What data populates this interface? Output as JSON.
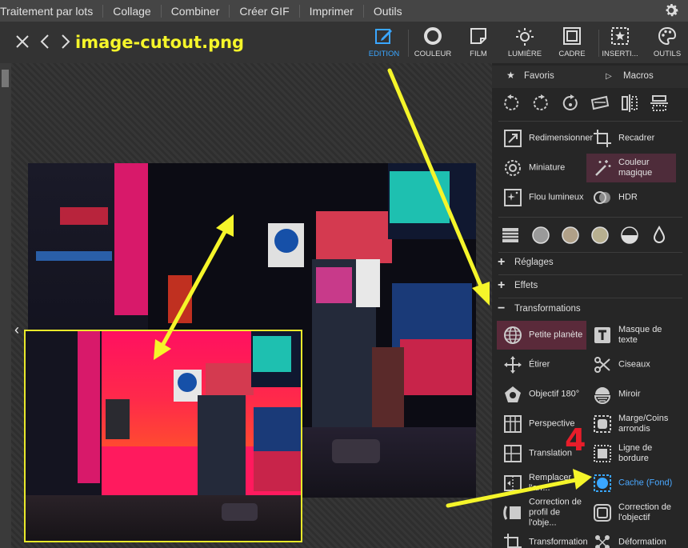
{
  "menu": {
    "items": [
      "Traitement par lots",
      "Collage",
      "Combiner",
      "Créer GIF",
      "Imprimer",
      "Outils"
    ]
  },
  "toolbar": {
    "filename": "image-cutout.png",
    "tools": [
      {
        "label": "EDITION",
        "icon": "edit-icon",
        "active": true
      },
      {
        "label": "COULEUR",
        "icon": "circle-icon"
      },
      {
        "label": "FILM",
        "icon": "film-icon"
      },
      {
        "label": "LUMIÈRE",
        "icon": "sun-icon"
      },
      {
        "label": "CADRE",
        "icon": "frame-icon"
      },
      {
        "label": "INSERTI...",
        "icon": "insert-icon"
      },
      {
        "label": "OUTILS",
        "icon": "palette-icon"
      }
    ]
  },
  "panel": {
    "favoris": "Favoris",
    "macros": "Macros",
    "tools": [
      {
        "label": "Redimensionner"
      },
      {
        "label": "Recadrer"
      },
      {
        "label": "Miniature"
      },
      {
        "label": "Couleur magique"
      },
      {
        "label": "Flou lumineux"
      },
      {
        "label": "HDR"
      }
    ],
    "sections": {
      "reglages": "Réglages",
      "effets": "Effets",
      "transformations": "Transformations"
    },
    "transformations": [
      {
        "label": "Petite planète"
      },
      {
        "label": "Masque de texte"
      },
      {
        "label": "Étirer"
      },
      {
        "label": "Ciseaux"
      },
      {
        "label": "Objectif 180°"
      },
      {
        "label": "Miroir"
      },
      {
        "label": "Perspective"
      },
      {
        "label": "Marge/Coins arrondis"
      },
      {
        "label": "Translation"
      },
      {
        "label": "Ligne de bordure"
      },
      {
        "label": "Remplacer l'arr..."
      },
      {
        "label": "Cache (Fond)"
      },
      {
        "label": "Correction de profil de l'obje..."
      },
      {
        "label": "Correction de l'objectif"
      },
      {
        "label": "Transformation"
      },
      {
        "label": "Déformation"
      }
    ]
  },
  "annotation": {
    "step_number": "4",
    "color": "#f5f52a"
  },
  "colors": {
    "accent": "#3aa6ff",
    "highlight": "#f5f52a"
  }
}
